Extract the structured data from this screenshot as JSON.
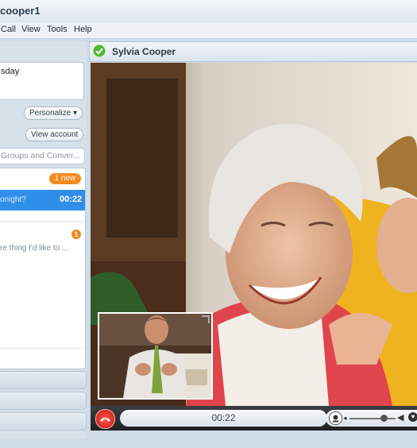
{
  "window": {
    "title": "cooper1"
  },
  "menu": [
    "Call",
    "View",
    "Tools",
    "Help"
  ],
  "sidebar": {
    "mood_text": "sday",
    "personalize_label": "Personalize ▾",
    "view_account_label": "View account",
    "search_placeholder": "Groups and Conver...",
    "new_badge": "1 new",
    "active_item": {
      "text": "onight?",
      "time": "00:22"
    },
    "other_item": {
      "text": "re thing I'd like to ...",
      "badge": "1"
    }
  },
  "call": {
    "contact_name": "Sylvia Cooper",
    "timer": "00:22",
    "volume_level": 0.75
  },
  "icons": [
    "skype-status-icon",
    "hang-up-icon",
    "webcam-icon",
    "speaker-low-icon",
    "speaker-high-icon",
    "heart-icon"
  ]
}
